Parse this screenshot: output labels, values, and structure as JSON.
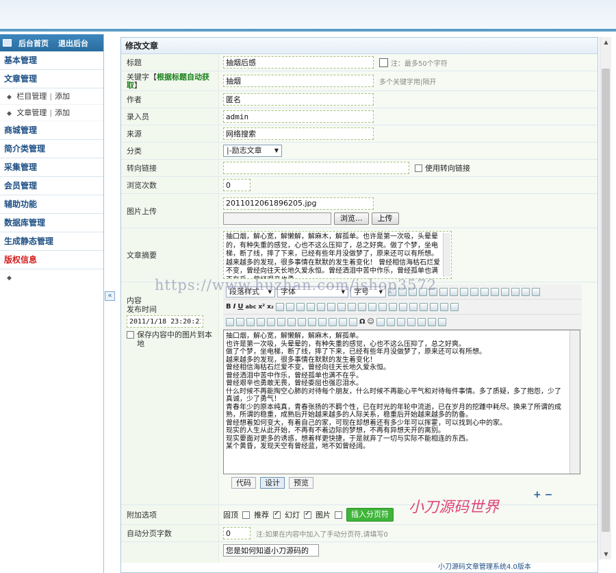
{
  "sidebar": {
    "head_home": "后台首页",
    "head_logout": "退出后台",
    "cats": [
      "基本管理",
      "文章管理",
      "商城管理",
      "简介类管理",
      "采集管理",
      "会员管理",
      "辅助功能",
      "数据库管理",
      "生成静态管理",
      "版权信息"
    ],
    "sub_column": "栏目管理",
    "sub_article": "文章管理",
    "sub_add": "添加",
    "sep": "|"
  },
  "collapse_label": "«",
  "panel": {
    "title": "修改文章",
    "fields": {
      "title_label": "标题",
      "title_value": "抽烟后感",
      "title_hint": "注：最多50个字符",
      "keyword_label": "关键字【",
      "keyword_link": "根据标题自动获取",
      "keyword_close": "】",
      "keyword_value": "抽烟",
      "keyword_hint": "多个关键字用|隔开",
      "author_label": "作者",
      "author_value": "匿名",
      "entry_label": "录入员",
      "entry_value": "admin",
      "source_label": "来源",
      "source_value": "网络搜索",
      "category_label": "分类",
      "category_value": "|-励志文章",
      "redirect_label": "转向链接",
      "redirect_value": "",
      "redirect_check": "使用转向链接",
      "views_label": "浏览次数",
      "views_value": "0",
      "image_label": "图片上传",
      "image_value": "2011012061896205.jpg",
      "browse_btn": "浏览...",
      "upload_btn": "上传",
      "abstract_label": "文章摘要",
      "abstract_text": "抽口烟，解心宽，解懒解，解麻木，解孤单。也许是第一次吸，头晕晕的，有种失重的感觉，心也不这么压抑了，总之好爽。做了个梦，坐电梯，断了线，摔了下来，已经有些年月没做梦了，原来还可以有所想。越来越多的发现，很多事情在默默的发生着变化！ 曾经相信海枯石烂爱不变，曾经向往天长地久爱永恒。曾经洒泪中苦中作乐，曾经孤单也满不在乎。曾经艰辛也勇",
      "content_label": "内容",
      "publish_label": "发布时间",
      "publish_value": "2011/1/18 23:20:23",
      "save_images": "保存内容中的图片到本地",
      "extra_label": "附加选项",
      "opt_top": "固顶",
      "opt_recommend": "推荐",
      "opt_slide": "幻灯",
      "opt_image": "图片",
      "insert_page_btn": "插入分页符",
      "autopage_label": "自动分页字数",
      "autopage_value": "0",
      "autopage_hint": "注:如果在内容中加入了手动分页符,请填写0",
      "question_value": "您是如何知道小刀源码的"
    }
  },
  "editor": {
    "style_sel": "段落样式",
    "font_sel": "字体",
    "size_sel": "字号",
    "lines": [
      "抽口烟，解心宽，解懒解，解麻木，解孤单。",
      "也许是第一次吸，头晕晕的，有种失重的感觉，心也不这么压抑了，总之好爽。",
      "做了个梦，坐电梯，断了线，摔了下来，已经有些年月没做梦了，原来还可以有所想。",
      "越来越多的发现，很多事情在默默的发生着变化！",
      "曾经相信海枯石烂爱不变，曾经向往天长地久爱永恒。",
      "曾经洒泪中苦中作乐，曾经孤单也满不在乎。",
      "曾经艰辛也勇敢无畏，曾经委屈也强忍泪水。",
      "什么时候不再能掏空心肺的对待每个朋友，什么时候不再能心平气和对待每件事情。多了质疑，多了抱怨，少了真诚，少了勇气！",
      "青春年少的原本纯真，青春张扬的不羁个性，已在时光的年轮中流逝，已在岁月的挖踵中耗尽。换来了所谓的成熟，所谓的稳重，成熟后开始越来越多的人际关系，稳重后开始越来越多的防备。",
      "曾经想着如何变大，有着自己的家，可现在却想着还有多少年可以挥霍，可以找到心中的家。",
      "现实的人生从此开始，不再有不着边际的梦想，不再有异想天开的离别。",
      "现实要面对更多的诱惑，想着样更快捷，于是就弃了一切与实际不能相连的东西。",
      "某个黄昏，发现天空有曾经蓝，地不如曾经阔。"
    ],
    "tab_code": "代码",
    "tab_design": "设计",
    "tab_preview": "预览"
  },
  "watermark_url": "https://www.huzhan.com/ishop3572",
  "watermark_brand": "小刀源码世界",
  "footer": "小刀源码文章管理系统4.0版本"
}
